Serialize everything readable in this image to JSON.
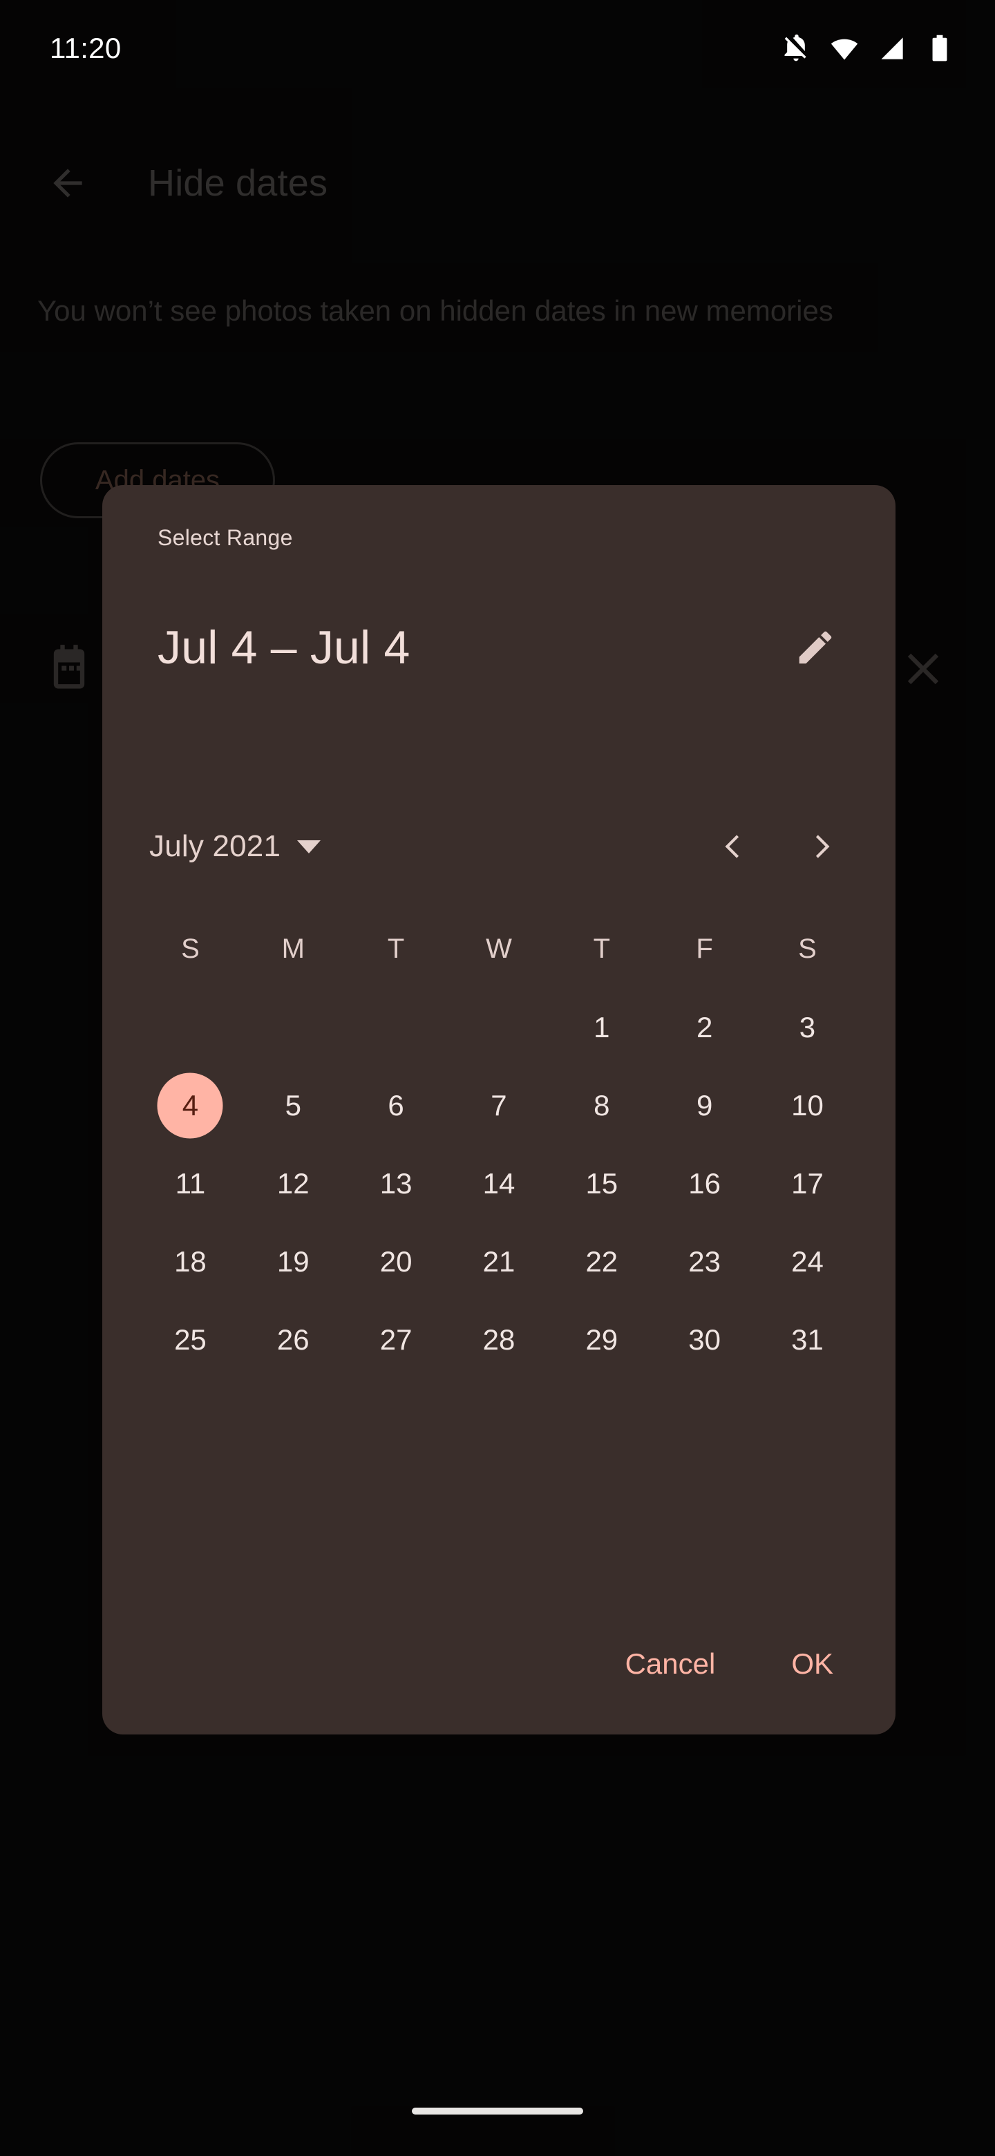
{
  "status_bar": {
    "time": "11:20",
    "icons": [
      "notifications-off-icon",
      "wifi-icon",
      "cellular-signal-icon",
      "battery-icon"
    ]
  },
  "background_page": {
    "back_icon": "arrow-back-icon",
    "title": "Hide dates",
    "description": "You won’t see photos taken on hidden dates in new memories",
    "add_dates_label": "Add dates",
    "row_calendar_icon": "calendar-icon",
    "row_close_icon": "close-icon"
  },
  "dialog": {
    "supporting_text": "Select Range",
    "headline": "Jul 4 – Jul 4",
    "edit_icon": "pencil-edit-icon",
    "month_year": "July 2021",
    "dropdown_icon": "chevron-down-icon",
    "prev_icon": "chevron-left-icon",
    "next_icon": "chevron-right-icon",
    "weekdays": [
      "S",
      "M",
      "T",
      "W",
      "T",
      "F",
      "S"
    ],
    "weeks": [
      [
        "",
        "",
        "",
        "",
        "1",
        "2",
        "3"
      ],
      [
        "4",
        "5",
        "6",
        "7",
        "8",
        "9",
        "10"
      ],
      [
        "11",
        "12",
        "13",
        "14",
        "15",
        "16",
        "17"
      ],
      [
        "18",
        "19",
        "20",
        "21",
        "22",
        "23",
        "24"
      ],
      [
        "25",
        "26",
        "27",
        "28",
        "29",
        "30",
        "31"
      ]
    ],
    "selected_days": [
      "4"
    ],
    "cancel_label": "Cancel",
    "ok_label": "OK"
  },
  "nav_bar": {
    "gesture_pill": "home-gesture-pill"
  },
  "colors": {
    "screen_background": "#0C0B0B",
    "dialog_surface": "#3A2E2B",
    "accent": "#FFB4A5",
    "on_accent": "#561F12",
    "dialog_text": "#F1E6E3",
    "dimmed_text": "#6A6765"
  }
}
